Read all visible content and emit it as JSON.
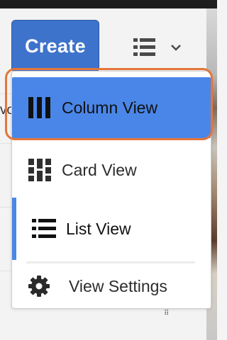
{
  "toolbar": {
    "create_label": "Create"
  },
  "view_menu": {
    "items": [
      {
        "label": "Column View",
        "icon": "column-view-icon",
        "selected": true
      },
      {
        "label": "Card View",
        "icon": "card-view-icon",
        "selected": false
      },
      {
        "label": "List View",
        "icon": "list-view-icon",
        "selected": false,
        "active": true
      },
      {
        "label": "View Settings",
        "icon": "gear-icon",
        "selected": false
      }
    ]
  },
  "background": {
    "fragment_text": "vo"
  },
  "colors": {
    "accent": "#4a86e8",
    "create_button": "#3e73cb",
    "highlight_ring": "#e3763a"
  }
}
